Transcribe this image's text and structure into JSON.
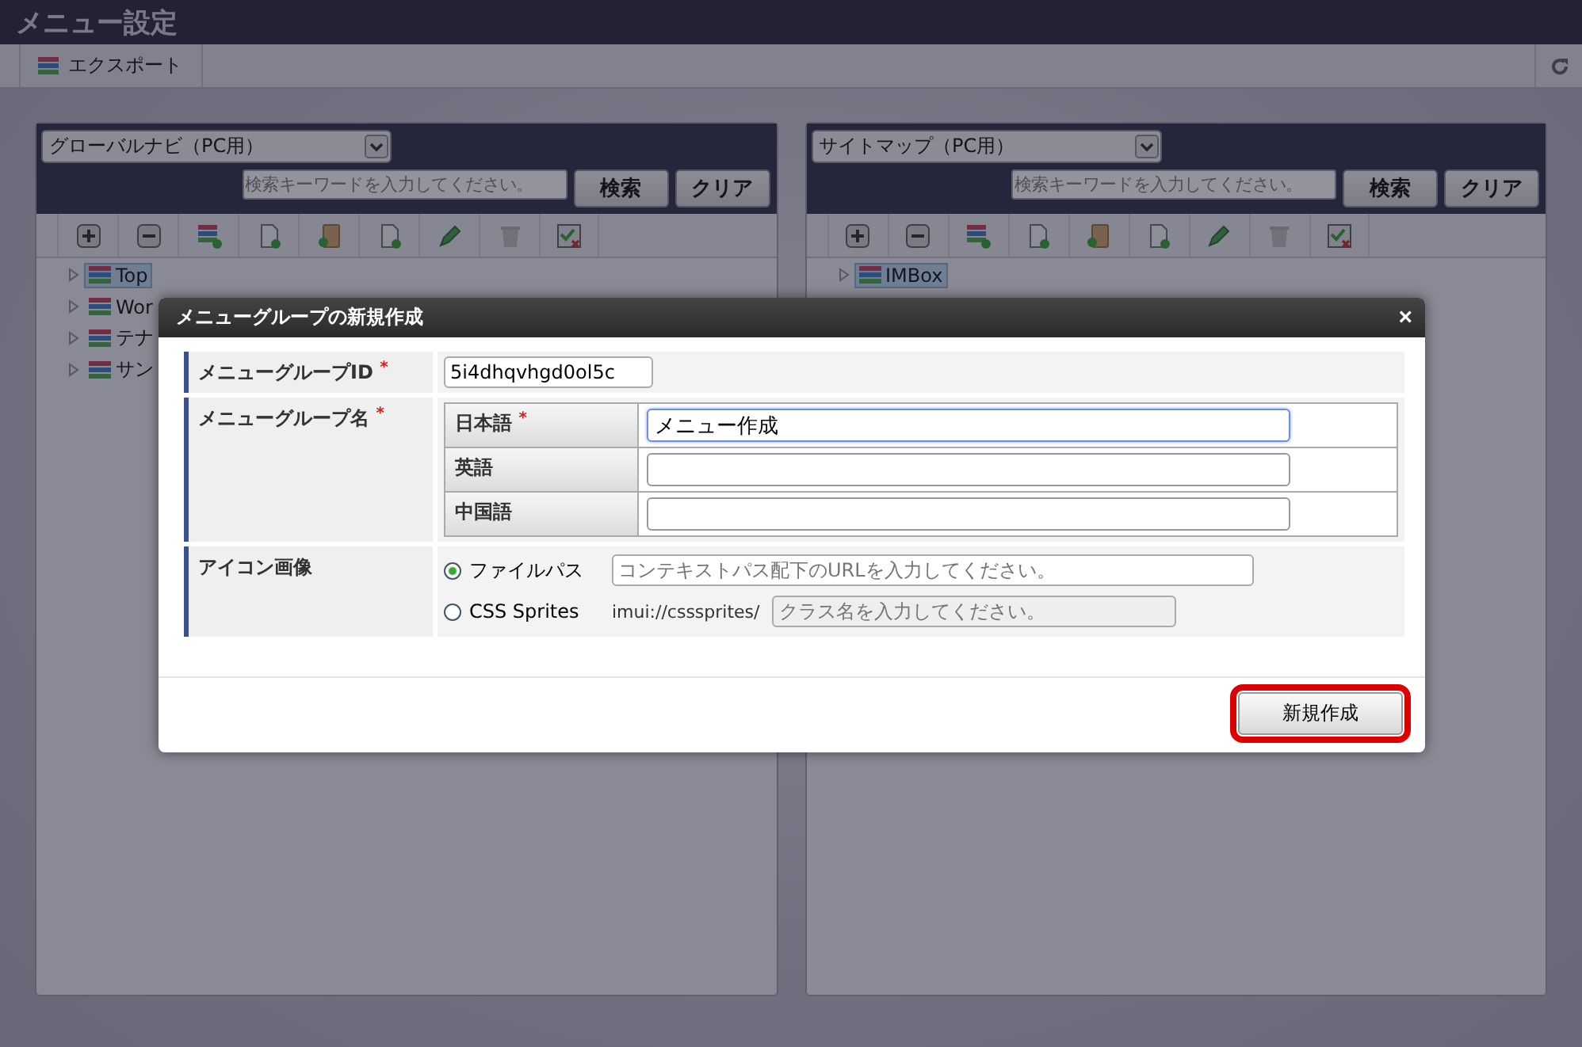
{
  "window": {
    "title": "メニュー設定"
  },
  "toolbar": {
    "export_button": "エクスポート"
  },
  "panels": [
    {
      "select": "グローバルナビ（PC用）",
      "search": {
        "placeholder": "検索キーワードを入力してください。"
      },
      "search_button": "検索",
      "clear_button": "クリア",
      "tree": [
        {
          "label": "Top",
          "selected": true
        },
        {
          "label": "Wor",
          "selected": false
        },
        {
          "label": "テナ",
          "selected": false
        },
        {
          "label": "サン",
          "selected": false
        }
      ]
    },
    {
      "select": "サイトマップ（PC用）",
      "search": {
        "placeholder": "検索キーワードを入力してください。"
      },
      "search_button": "検索",
      "clear_button": "クリア",
      "tree": [
        {
          "label": "IMBox",
          "selected": true
        }
      ]
    }
  ],
  "dialog": {
    "title": "メニューグループの新規作成",
    "close": "×",
    "id_label": "メニューグループID",
    "id_required": "*",
    "id_value": "5i4dhqvhgd0ol5c",
    "name_label": "メニューグループ名",
    "name_required": "*",
    "names": [
      {
        "label": "日本語",
        "required": "*",
        "value": "メニュー作成",
        "focused": true
      },
      {
        "label": "英語",
        "focused": false
      },
      {
        "label": "中国語",
        "focused": false
      }
    ],
    "icon_label": "アイコン画像",
    "icon_options": [
      {
        "label": "ファイルパス",
        "selected": true,
        "placeholder": "コンテキストパス配下のURLを入力してください。"
      },
      {
        "label": "CSS Sprites",
        "selected": false,
        "prefix": "imui://csssprites/",
        "placeholder": "クラス名を入力してください。"
      }
    ],
    "create_button": {
      "label": "新規作成",
      "highlighted": true
    }
  }
}
